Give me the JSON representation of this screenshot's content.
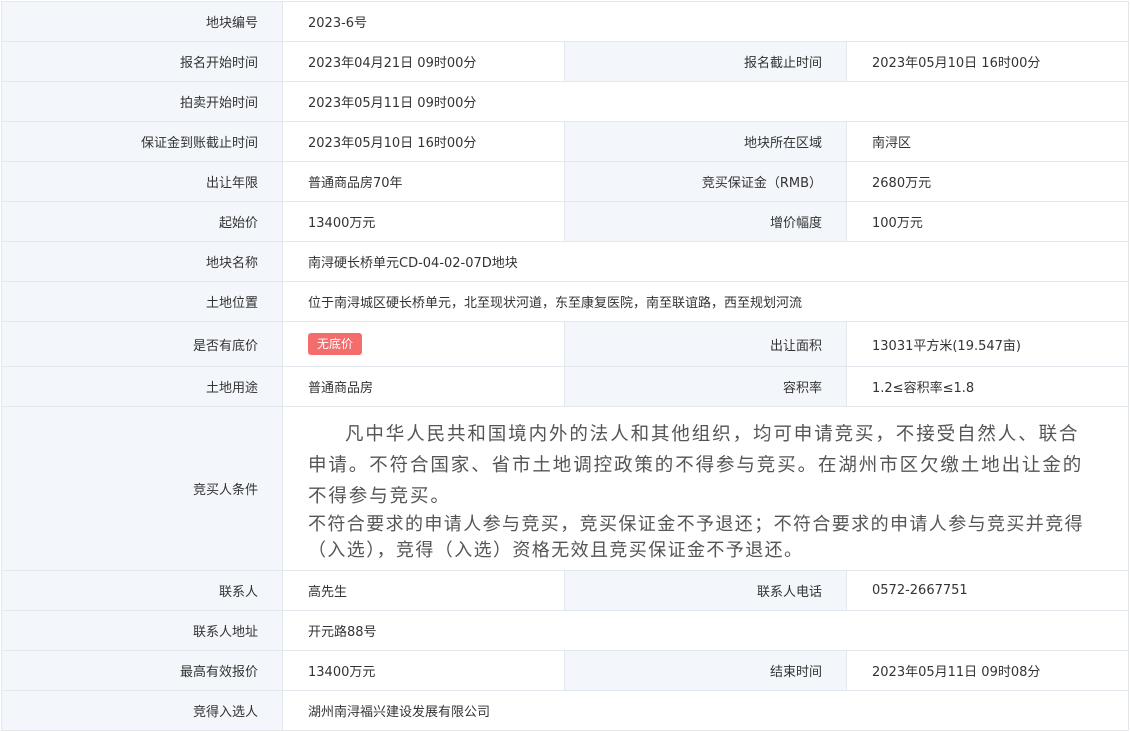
{
  "rows": {
    "parcel_no": {
      "label": "地块编号",
      "value": "2023-6号"
    },
    "signup_start": {
      "label": "报名开始时间",
      "value": "2023年04月21日 09时00分"
    },
    "signup_end": {
      "label": "报名截止时间",
      "value": "2023年05月10日 16时00分"
    },
    "auction_start": {
      "label": "拍卖开始时间",
      "value": "2023年05月11日 09时00分"
    },
    "deposit_deadline": {
      "label": "保证金到账截止时间",
      "value": "2023年05月10日 16时00分"
    },
    "district": {
      "label": "地块所在区域",
      "value": "南浔区"
    },
    "term": {
      "label": "出让年限",
      "value": "普通商品房70年"
    },
    "deposit": {
      "label": "竞买保证金（RMB）",
      "value": "2680万元"
    },
    "start_price": {
      "label": "起始价",
      "value": "13400万元"
    },
    "increment": {
      "label": "增价幅度",
      "value": "100万元"
    },
    "parcel_name": {
      "label": "地块名称",
      "value": "南浔硬长桥单元CD-04-02-07D地块"
    },
    "location": {
      "label": "土地位置",
      "value": "位于南浔城区硬长桥单元，北至现状河道，东至康复医院，南至联谊路，西至规划河流"
    },
    "reserve": {
      "label": "是否有底价",
      "badge": "无底价"
    },
    "area": {
      "label": "出让面积",
      "value": "13031平方米(19.547亩)"
    },
    "usage": {
      "label": "土地用途",
      "value": "普通商品房"
    },
    "plot_ratio": {
      "label": "容积率",
      "value": "1.2≤容积率≤1.8"
    },
    "bidder_conditions": {
      "label": "竞买人条件",
      "paragraph1": "凡中华人民共和国境内外的法人和其他组织，均可申请竞买，不接受自然人、联合申请。不符合国家、省市土地调控政策的不得参与竞买。在湖州市区欠缴土地出让金的不得参与竞买。",
      "paragraph2": "不符合要求的申请人参与竞买，竞买保证金不予退还；不符合要求的申请人参与竞买并竞得（入选），竞得（入选）资格无效且竞买保证金不予退还。"
    },
    "contact": {
      "label": "联系人",
      "value": "高先生"
    },
    "contact_phone": {
      "label": "联系人电话",
      "value": "0572-2667751"
    },
    "contact_address": {
      "label": "联系人地址",
      "value": "开元路88号"
    },
    "top_bid": {
      "label": "最高有效报价",
      "value": "13400万元"
    },
    "end_time": {
      "label": "结束时间",
      "value": "2023年05月11日 09时08分"
    },
    "winner": {
      "label": "竞得入选人",
      "value": "湖州南浔福兴建设发展有限公司"
    }
  },
  "colors": {
    "label_bg": "#f3f6fa",
    "border": "#e3e8ef",
    "badge_bg": "#f56c6c",
    "text": "#333333"
  }
}
